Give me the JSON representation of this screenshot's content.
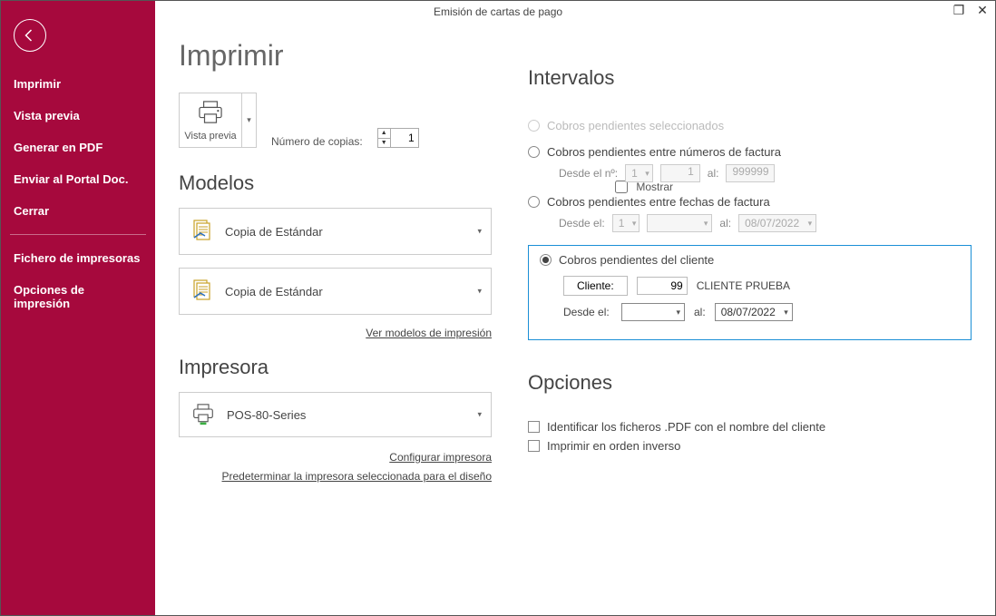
{
  "window": {
    "title": "Emisión de cartas de pago"
  },
  "sidebar": {
    "items": [
      {
        "label": "Imprimir"
      },
      {
        "label": "Vista previa"
      },
      {
        "label": "Generar en PDF"
      },
      {
        "label": "Enviar al Portal Doc."
      },
      {
        "label": "Cerrar"
      }
    ],
    "items2": [
      {
        "label": "Fichero de impresoras"
      },
      {
        "label": "Opciones de impresión"
      }
    ]
  },
  "page": {
    "heading": "Imprimir",
    "vistaprevia": "Vista previa",
    "copies_label": "Número de copias:",
    "copies_value": "1",
    "modelos_heading": "Modelos",
    "mostrar_label": "Mostrar",
    "model1": "Copia de Estándar",
    "model2": "Copia de Estándar",
    "link_modelos": "Ver modelos de impresión",
    "impresora_heading": "Impresora",
    "printer_name": "POS-80-Series",
    "link_config": "Configurar impresora",
    "link_predet": "Predeterminar la impresora seleccionada para el diseño"
  },
  "intervalos": {
    "heading": "Intervalos",
    "opt1": "Cobros pendientes seleccionados",
    "opt2": "Cobros pendientes entre números de factura",
    "opt2_from": "Desde el nº:",
    "opt2_v1": "1",
    "opt2_v2": "1",
    "opt2_al": "al:",
    "opt2_v3": "999999",
    "opt3": "Cobros pendientes entre fechas de factura",
    "opt3_from": "Desde el:",
    "opt3_v1": "1",
    "opt3_al": "al:",
    "opt3_date": "08/07/2022",
    "opt4": "Cobros pendientes del cliente",
    "cliente_btn": "Cliente:",
    "cliente_num": "99",
    "cliente_name": "CLIENTE PRUEBA",
    "desde": "Desde el:",
    "al": "al:",
    "hasta_date": "08/07/2022"
  },
  "opciones": {
    "heading": "Opciones",
    "chk1": "Identificar los ficheros .PDF con el nombre del cliente",
    "chk2": "Imprimir en orden inverso"
  }
}
